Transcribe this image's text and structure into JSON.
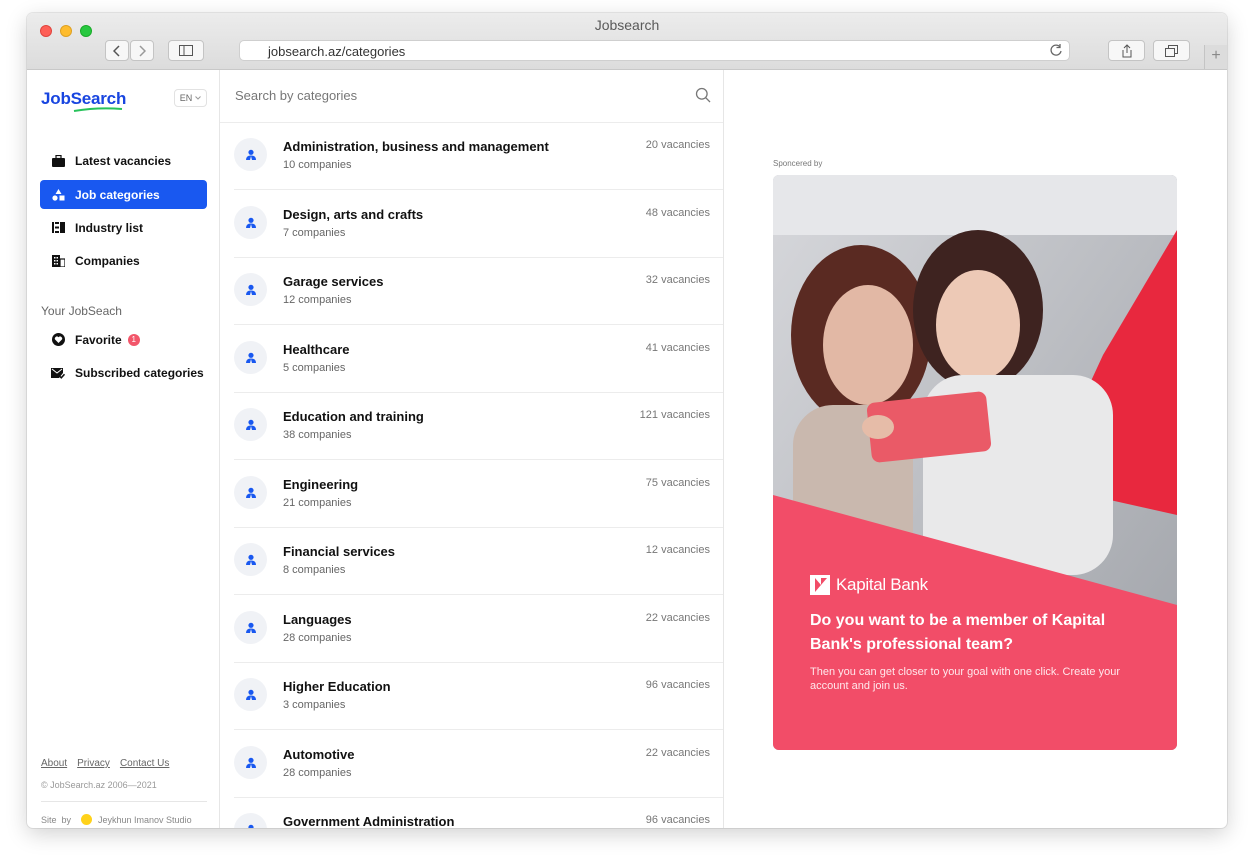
{
  "window": {
    "title": "Jobsearch",
    "url": "jobsearch.az/categories"
  },
  "sidebar": {
    "logo": "JobSearch",
    "lang": "EN",
    "nav": [
      {
        "label": "Latest vacancies",
        "icon": "briefcase-icon"
      },
      {
        "label": "Job categories",
        "icon": "categories-icon",
        "active": true
      },
      {
        "label": "Industry list",
        "icon": "list-icon"
      },
      {
        "label": "Companies",
        "icon": "building-icon"
      }
    ],
    "section_label": "Your JobSeach",
    "personal": [
      {
        "label": "Favorite",
        "icon": "heart-icon",
        "badge": "1"
      },
      {
        "label": "Subscribed categories",
        "icon": "mail-check-icon"
      }
    ],
    "footer": {
      "links": [
        "About",
        "Privacy",
        "Contact Us"
      ],
      "copyright": "© JobSearch.az 2006—2021",
      "site_by": "Site  by",
      "studio": "Jeykhun Imanov Studio"
    }
  },
  "search": {
    "placeholder": "Search by categories"
  },
  "categories": [
    {
      "name": "Administration, business and management",
      "companies": "10 companies",
      "vacancies": "20 vacancies"
    },
    {
      "name": "Design, arts and crafts",
      "companies": "7 companies",
      "vacancies": "48 vacancies"
    },
    {
      "name": "Garage services",
      "companies": "12 companies",
      "vacancies": "32 vacancies"
    },
    {
      "name": "Healthcare",
      "companies": "5 companies",
      "vacancies": "41 vacancies"
    },
    {
      "name": "Education and training",
      "companies": "38 companies",
      "vacancies": "121 vacancies"
    },
    {
      "name": "Engineering",
      "companies": "21 companies",
      "vacancies": "75 vacancies"
    },
    {
      "name": "Financial services",
      "companies": "8 companies",
      "vacancies": "12 vacancies"
    },
    {
      "name": "Languages",
      "companies": "28 companies",
      "vacancies": "22 vacancies"
    },
    {
      "name": "Higher Education",
      "companies": "3 companies",
      "vacancies": "96 vacancies"
    },
    {
      "name": "Automotive",
      "companies": "28 companies",
      "vacancies": "22 vacancies"
    },
    {
      "name": "Government Administration",
      "companies": "",
      "vacancies": "96 vacancies"
    }
  ],
  "ad": {
    "sponsored_label": "Sponcered by",
    "brand": "Kapital Bank",
    "headline": "Do you want to be a member of Kapital Bank's professional team?",
    "text": "Then you can get closer to your goal with one click. Create your account and join us.",
    "accent_color": "#f24d68"
  },
  "colors": {
    "primary": "#1958f0",
    "badge": "#f2566a"
  }
}
